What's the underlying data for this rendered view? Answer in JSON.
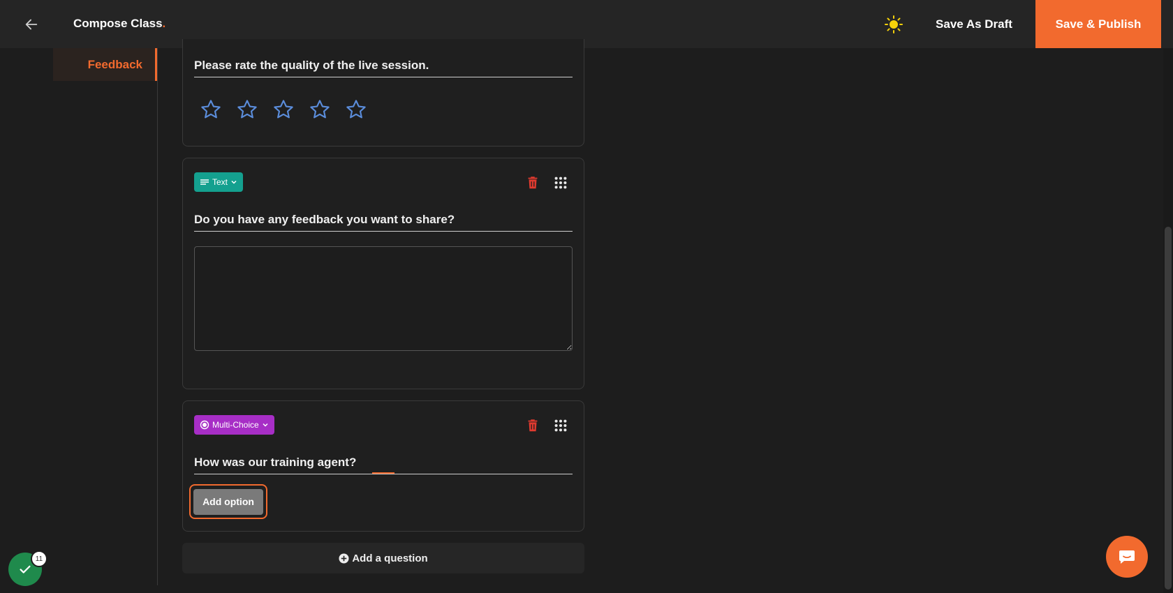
{
  "header": {
    "title": "Compose Class",
    "title_dot": ".",
    "save_draft_label": "Save As Draft",
    "publish_label": "Save & Publish"
  },
  "sidebar": {
    "active_item": "Feedback"
  },
  "questions": [
    {
      "title": "Please rate the quality of the live session.",
      "type": "rating",
      "stars": 5,
      "rating": 0
    },
    {
      "title": "Do you have any feedback you want to share?",
      "type_label": "Text",
      "answer_value": ""
    },
    {
      "title": "How was our training agent?",
      "type_label": "Multi-Choice",
      "add_option_label": "Add option"
    }
  ],
  "add_question_label": "Add a question",
  "badge_count": "11",
  "colors": {
    "accent": "#f26a2e",
    "text_badge": "#14a08f",
    "multichoice_badge": "#a72ec6",
    "star": "#5b8ddb",
    "trash": "#e03a2f",
    "check_fab": "#1f8a4c"
  },
  "icons": [
    "back-arrow-icon",
    "sun-icon",
    "star-icon",
    "text-lines-icon",
    "chevron-down-icon",
    "radio-icon",
    "trash-icon",
    "grip-icon",
    "plus-circle-icon",
    "check-icon",
    "chat-icon"
  ]
}
